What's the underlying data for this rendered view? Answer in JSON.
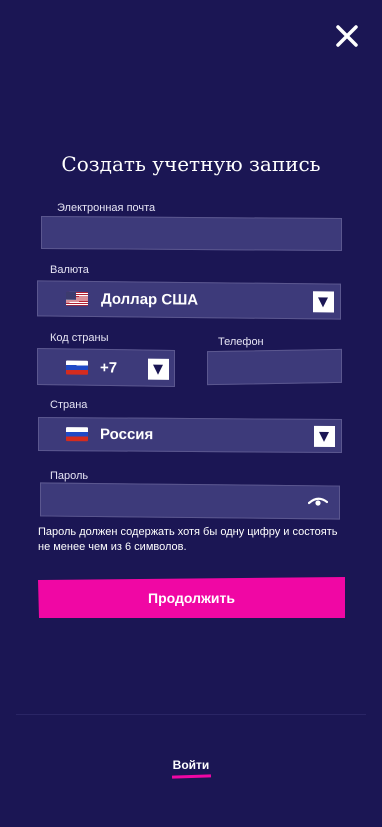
{
  "header": {
    "close_icon": "close-icon"
  },
  "form": {
    "title": "Создать учетную запись",
    "email": {
      "label": "Электронная почта",
      "value": "",
      "placeholder": ""
    },
    "currency": {
      "label": "Валюта",
      "flag": "us-flag-icon",
      "value": "Доллар США"
    },
    "country_code": {
      "label": "Код страны",
      "flag": "ru-flag-icon",
      "value": "+7"
    },
    "phone": {
      "label": "Телефон",
      "value": ""
    },
    "country": {
      "label": "Страна",
      "flag": "ru-flag-icon",
      "value": "Россия"
    },
    "password": {
      "label": "Пароль",
      "value": "",
      "toggle_icon": "eye-icon"
    },
    "hint": "Пароль должен содержать хотя бы одну цифру и состоять не менее чем из 6 символов.",
    "submit_label": "Продолжить"
  },
  "footer": {
    "login_label": "Войти"
  },
  "colors": {
    "background": "#1b1654",
    "field": "#3d3a7a",
    "accent": "#f007a4"
  }
}
